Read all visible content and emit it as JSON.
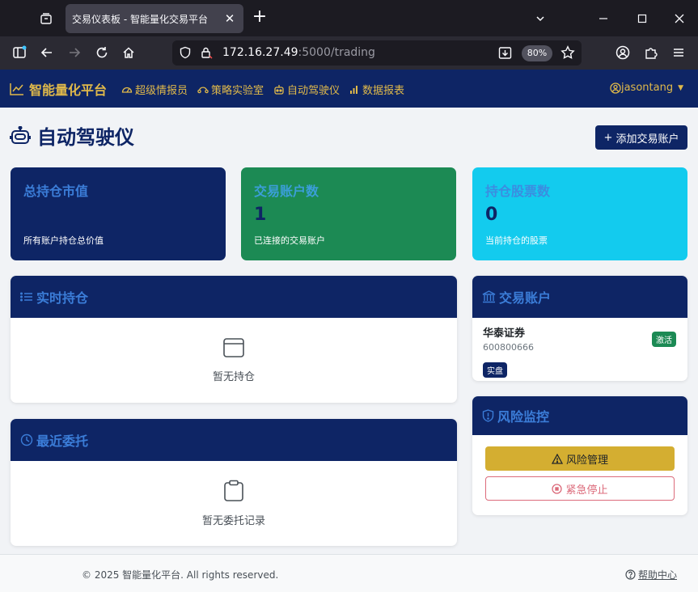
{
  "browser": {
    "tab_title": "交易仪表板 - 智能量化交易平台",
    "url_host": "172.16.27.49",
    "url_rest": ":5000/trading",
    "zoom": "80%"
  },
  "appnav": {
    "brand": "智能量化平台",
    "links": [
      {
        "label": "超级情报员",
        "icon": "gauge-icon"
      },
      {
        "label": "策略实验室",
        "icon": "route-icon"
      },
      {
        "label": "自动驾驶仪",
        "icon": "robot-icon"
      },
      {
        "label": "数据报表",
        "icon": "bar-chart-icon"
      }
    ],
    "user": "jasontang"
  },
  "page": {
    "title": "自动驾驶仪",
    "add_account_label": "添加交易账户"
  },
  "stats": [
    {
      "title": "总持仓市值",
      "value": "",
      "sub": "所有账户持仓总价值"
    },
    {
      "title": "交易账户数",
      "value": "1",
      "sub": "已连接的交易账户"
    },
    {
      "title": "持仓股票数",
      "value": "0",
      "sub": "当前持仓的股票"
    }
  ],
  "positions": {
    "title": "实时持仓",
    "empty": "暂无持仓"
  },
  "orders": {
    "title": "最近委托",
    "empty": "暂无委托记录"
  },
  "accounts": {
    "title": "交易账户",
    "items": [
      {
        "name": "华泰证券",
        "id": "600800666",
        "status": "激活",
        "type": "实盘"
      }
    ]
  },
  "risk": {
    "title": "风险监控",
    "manage_label": "风险管理",
    "stop_label": "紧急停止"
  },
  "footer": {
    "copyright": "© 2025 智能量化平台. All rights reserved.",
    "help": "帮助中心"
  },
  "colors": {
    "navy": "#0e2565",
    "gold": "#e0b94a",
    "green": "#1c8a54",
    "cyan": "#13cbee",
    "warning": "#d4ae31",
    "danger": "#dc6b7b"
  }
}
